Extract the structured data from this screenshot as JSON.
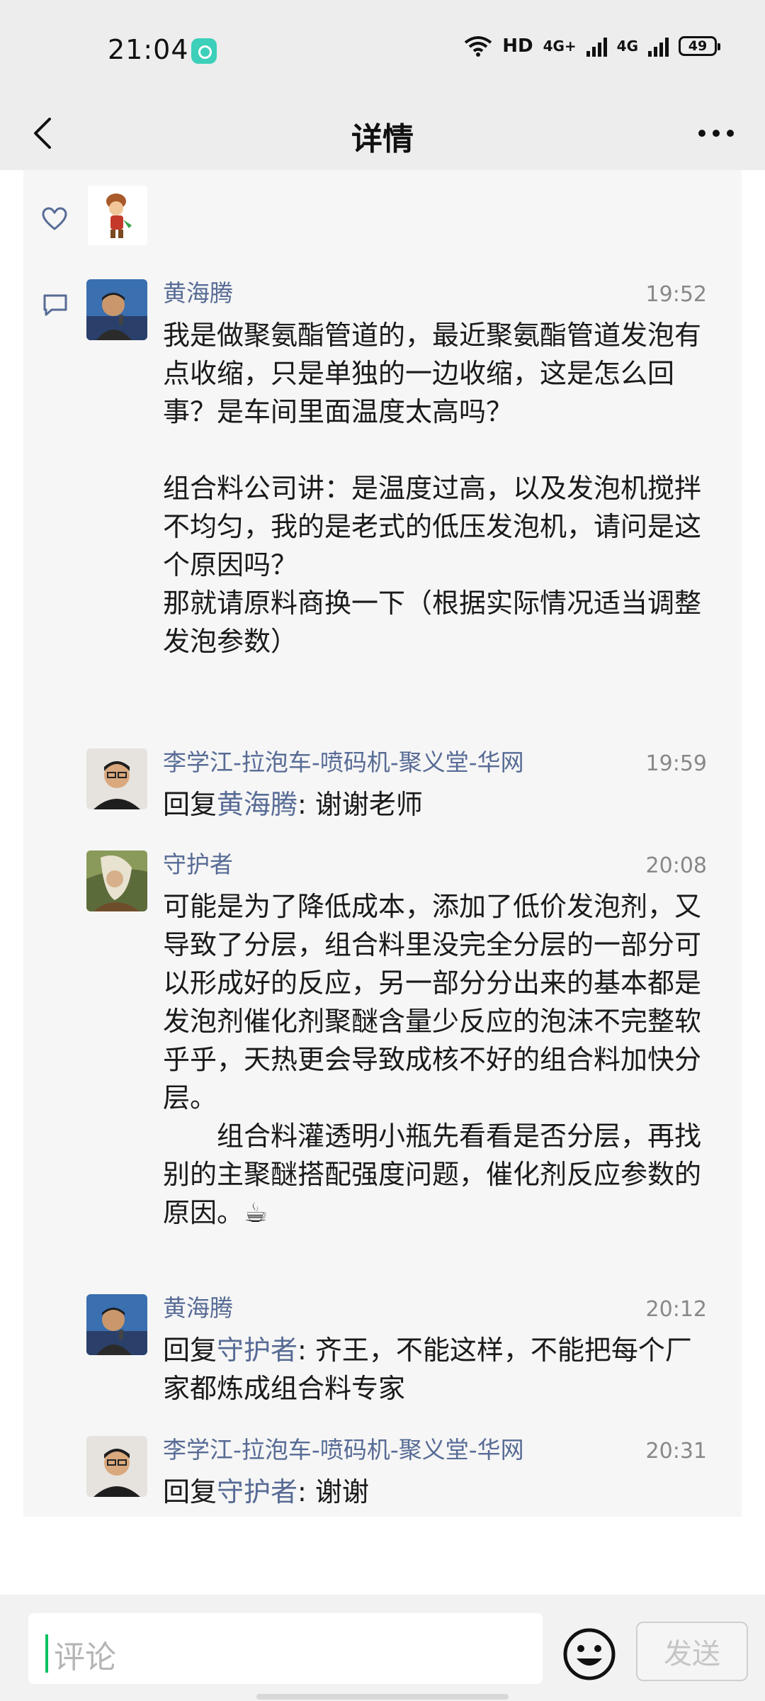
{
  "status_bar": {
    "time": "21:04",
    "network": "HD",
    "net_type_1": "4G+",
    "net_type_2": "4G",
    "battery": "49"
  },
  "nav": {
    "title": "详情",
    "back_icon": "back-chevron-icon",
    "more_icon": "more-dots-icon"
  },
  "likes": {
    "icon": "heart-icon",
    "comment_icon": "comment-icon"
  },
  "comments": [
    {
      "author": "黄海腾",
      "time": "19:52",
      "paragraphs": [
        "我是做聚氨酯管道的，最近聚氨酯管道发泡有点收缩，只是单独的一边收缩，这是怎么回事？是车间里面温度太高吗？",
        "",
        "组合料公司讲：是温度过高，以及发泡机搅拌不均匀，我的是老式的低压发泡机，请问是这个原因吗？",
        "那就请原料商换一下（根据实际情况适当调整发泡参数）"
      ]
    },
    {
      "author": "李学江-拉泡车-喷码机-聚义堂-华网",
      "time": "19:59",
      "reply_prefix": "回复",
      "reply_to": "黄海腾",
      "reply_text": ": 谢谢老师"
    },
    {
      "author": "守护者",
      "time": "20:08",
      "paragraphs": [
        "可能是为了降低成本，添加了低价发泡剂，又导致了分层，组合料里没完全分层的一部分可以形成好的反应，另一部分分出来的基本都是发泡剂催化剂聚醚含量少反应的泡沫不完整软乎乎，天热更会导致成核不好的组合料加快分层。",
        "组合料灌透明小瓶先看看是否分层，再找别的主聚醚搭配强度问题，催化剂反应参数的原因。☕"
      ]
    },
    {
      "author": "黄海腾",
      "time": "20:12",
      "reply_prefix": "回复",
      "reply_to": "守护者",
      "reply_text": ": 齐王，不能这样，不能把每个厂家都炼成组合料专家"
    },
    {
      "author": "李学江-拉泡车-喷码机-聚义堂-华网",
      "time": "20:31",
      "reply_prefix": "回复",
      "reply_to": "守护者",
      "reply_text": ": 谢谢"
    }
  ],
  "bottom_bar": {
    "placeholder": "评论",
    "send_label": "发送",
    "emoji_icon": "emoji-icon"
  }
}
